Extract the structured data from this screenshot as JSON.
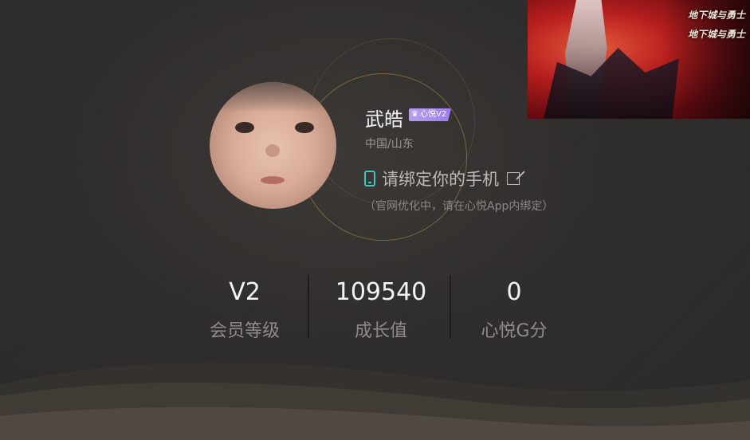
{
  "profile": {
    "name": "武皓",
    "badge": "心悦V2",
    "location": "中国/山东",
    "bind_phone_label": "请绑定你的手机",
    "bind_note": "（官网优化中，请在心悦App内绑定）"
  },
  "stats": [
    {
      "value": "V2",
      "label": "会员等级"
    },
    {
      "value": "109540",
      "label": "成长值"
    },
    {
      "value": "0",
      "label": "心悦G分"
    }
  ],
  "banner": {
    "logo_text": "地下城与勇士"
  },
  "icons": {
    "phone": "phone-icon",
    "edit": "edit-icon"
  },
  "colors": {
    "background": "#2e2d2c",
    "accent_teal": "#3ec6c0",
    "badge_purple": "#a88af3",
    "ring_gold": "#d2a050"
  }
}
